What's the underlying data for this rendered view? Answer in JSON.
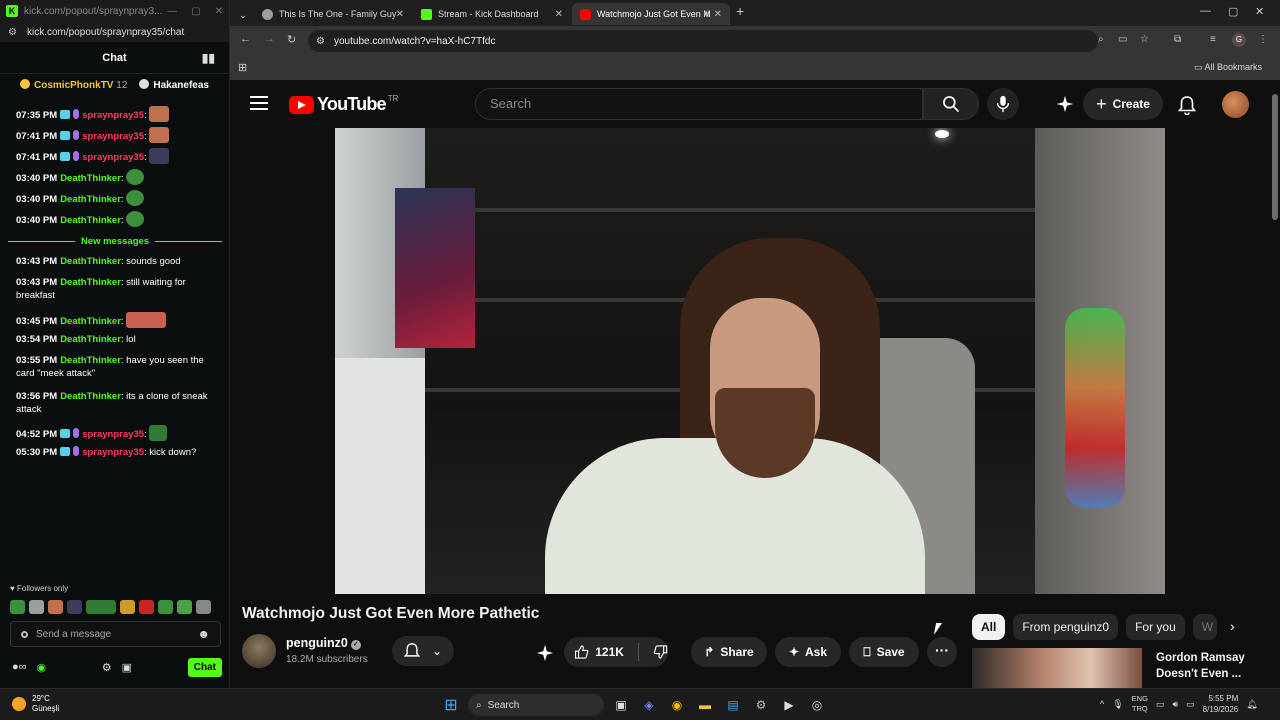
{
  "chat_window": {
    "title": "kick.com/popout/spraynpray3...",
    "url": "kick.com/popout/spraynpray35/chat",
    "header": "Chat",
    "pinned": {
      "user1": "CosmicPhonkTV",
      "user1_count": "12",
      "user2": "Hakanefeas"
    },
    "messages": [
      {
        "time": "07:35 PM",
        "user": "spraynpray35",
        "text": ":",
        "style": "red",
        "emote": "em-face"
      },
      {
        "time": "07:41 PM",
        "user": "spraynpray35",
        "text": ":",
        "style": "red",
        "emote": "em-face"
      },
      {
        "time": "07:41 PM",
        "user": "spraynpray35",
        "text": ":",
        "style": "red",
        "emote": "em-hat"
      },
      {
        "time": "03:40 PM",
        "user": "DeathThinker",
        "text": ":",
        "style": "green",
        "emote": "em-pepe"
      },
      {
        "time": "03:40 PM",
        "user": "DeathThinker",
        "text": ":",
        "style": "green",
        "emote": "em-pepe"
      },
      {
        "time": "03:40 PM",
        "user": "DeathThinker",
        "text": ":",
        "style": "green",
        "emote": "em-pepe"
      },
      {
        "time": "03:43 PM",
        "user": "DeathThinker",
        "text": ": sounds good",
        "style": "green",
        "emote": ""
      },
      {
        "time": "03:43 PM",
        "user": "DeathThinker",
        "text": ": still waiting for breakfast",
        "style": "green",
        "emote": ""
      },
      {
        "time": "03:45 PM",
        "user": "DeathThinker",
        "text": ":",
        "style": "green",
        "emote": "em-wide"
      },
      {
        "time": "03:54 PM",
        "user": "DeathThinker",
        "text": ": lol",
        "style": "green",
        "emote": ""
      },
      {
        "time": "03:55 PM",
        "user": "DeathThinker",
        "text": ": have you seen the card \"meek attack\"",
        "style": "green",
        "emote": ""
      },
      {
        "time": "03:56 PM",
        "user": "DeathThinker",
        "text": ": its a clone of sneak attack",
        "style": "green",
        "emote": ""
      },
      {
        "time": "04:52 PM",
        "user": "spraynpray35",
        "text": ":",
        "style": "red",
        "emote": "em-green"
      },
      {
        "time": "05:30 PM",
        "user": "spraynpray35",
        "text": ": kick down?",
        "style": "red",
        "emote": ""
      }
    ],
    "new_messages_label": "New messages",
    "followers_only": "Followers only",
    "send_placeholder": "Send a message",
    "chat_button": "Chat"
  },
  "browser": {
    "tabs": [
      {
        "title": "This Is The One - Family Guy",
        "favicon_color": "#9aa0a6"
      },
      {
        "title": "Stream - Kick Dashboard",
        "favicon_color": "#53fc18"
      },
      {
        "title": "Watchmojo Just Got Even M",
        "favicon_color": "#ff0000"
      }
    ],
    "url": "youtube.com/watch?v=haX-hC7Tfdc",
    "profile_letter": "G",
    "all_bookmarks": "All Bookmarks"
  },
  "youtube": {
    "logo_text": "YouTube",
    "region": "TR",
    "search_placeholder": "Search",
    "create_label": "Create",
    "video_title": "Watchmojo Just Got Even More Pathetic",
    "channel_name": "penguinz0",
    "subscribers": "18.2M subscribers",
    "likes": "121K",
    "share_label": "Share",
    "ask_label": "Ask",
    "save_label": "Save",
    "chips": [
      "All",
      "From penguinz0",
      "For you",
      "W"
    ],
    "recommended_title": "Gordon Ramsay Doesn't Even ..."
  },
  "taskbar": {
    "temperature": "29°C",
    "weather_place": "Güneşli",
    "search_label": "Search",
    "lang_top": "ENG",
    "lang_bottom": "TRQ",
    "time": "5:55 PM",
    "date": "8/19/2026"
  },
  "colors": {
    "kick_green": "#53fc18",
    "yt_red": "#ff0000",
    "user_red": "#ff3b5c"
  }
}
